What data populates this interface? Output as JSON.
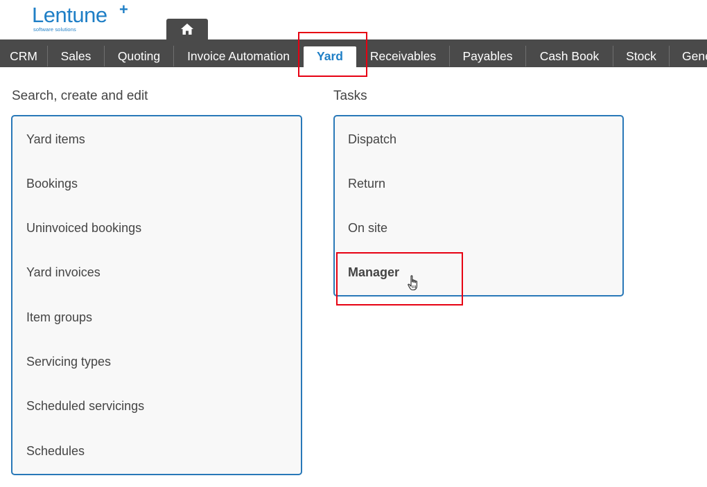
{
  "brand": {
    "name": "Lentune",
    "plus": "+",
    "tagline": "software solutions"
  },
  "nav": {
    "home_icon": "home-icon",
    "tabs": [
      {
        "label": "CRM"
      },
      {
        "label": "Sales"
      },
      {
        "label": "Quoting"
      },
      {
        "label": "Invoice Automation"
      },
      {
        "label": "Yard",
        "active": true
      },
      {
        "label": "Receivables"
      },
      {
        "label": "Payables"
      },
      {
        "label": "Cash Book"
      },
      {
        "label": "Stock"
      },
      {
        "label": "Gene"
      }
    ]
  },
  "search_panel": {
    "title": "Search, create and edit",
    "items": [
      "Yard items",
      "Bookings",
      "Uninvoiced bookings",
      "Yard invoices",
      "Item groups",
      "Servicing types",
      "Scheduled servicings",
      "Schedules"
    ]
  },
  "tasks_panel": {
    "title": "Tasks",
    "items": [
      "Dispatch",
      "Return",
      "On site",
      "Manager"
    ]
  },
  "colors": {
    "brand_blue": "#1f7fc6",
    "nav_bg": "#4a4a4a",
    "panel_border": "#2878b8",
    "highlight_red": "#e60012"
  }
}
